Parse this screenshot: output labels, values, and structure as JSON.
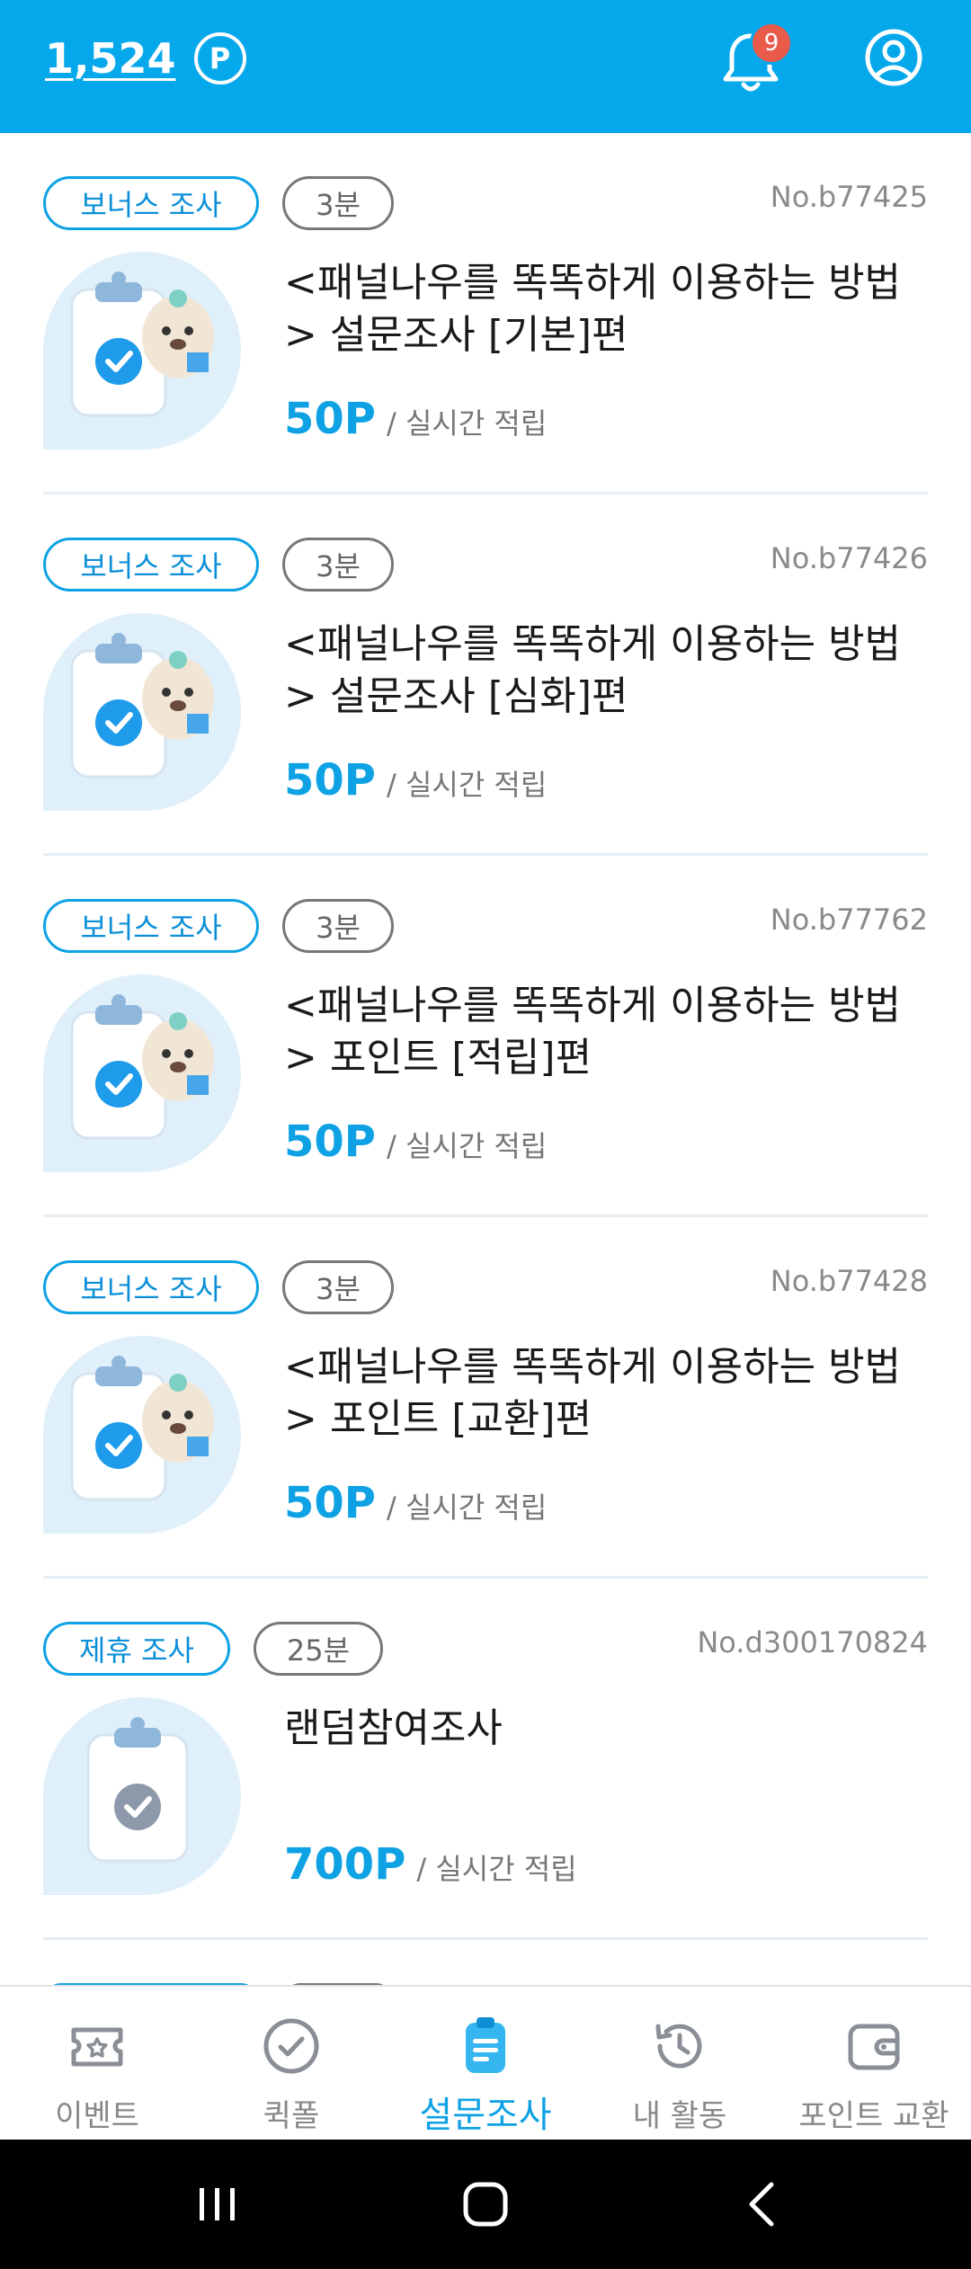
{
  "header": {
    "points": "1,524",
    "points_badge": "P",
    "notification_count": "9"
  },
  "surveys": [
    {
      "tag": "보너스 조사",
      "duration": "3분",
      "number": "No.b77425",
      "title": "<패널나우를 똑똑하게 이용하는 방법> 설문조사 [기본]편",
      "reward": "50P",
      "reward_note": "/ 실시간 적립",
      "thumbnail": "clipboard-bear"
    },
    {
      "tag": "보너스 조사",
      "duration": "3분",
      "number": "No.b77426",
      "title": "<패널나우를 똑똑하게 이용하는 방법> 설문조사 [심화]편",
      "reward": "50P",
      "reward_note": "/ 실시간 적립",
      "thumbnail": "clipboard-bear"
    },
    {
      "tag": "보너스 조사",
      "duration": "3분",
      "number": "No.b77762",
      "title": "<패널나우를 똑똑하게 이용하는 방법> 포인트 [적립]편",
      "reward": "50P",
      "reward_note": "/ 실시간 적립",
      "thumbnail": "clipboard-bear"
    },
    {
      "tag": "보너스 조사",
      "duration": "3분",
      "number": "No.b77428",
      "title": "<패널나우를 똑똑하게 이용하는 방법> 포인트 [교환]편",
      "reward": "50P",
      "reward_note": "/ 실시간 적립",
      "thumbnail": "clipboard-bear"
    },
    {
      "tag": "제휴 조사",
      "duration": "25분",
      "number": "No.d300170824",
      "title": "랜덤참여조사",
      "reward": "700P",
      "reward_note": "/ 실시간 적립",
      "thumbnail": "clipboard-gray"
    }
  ],
  "nav": {
    "items": [
      {
        "label": "이벤트",
        "icon": "event-ticket-icon",
        "active": false
      },
      {
        "label": "퀵폴",
        "icon": "quickpoll-check-icon",
        "active": false
      },
      {
        "label": "설문조사",
        "icon": "survey-document-icon",
        "active": true
      },
      {
        "label": "내 활동",
        "icon": "history-clock-icon",
        "active": false
      },
      {
        "label": "포인트 교환",
        "icon": "wallet-icon",
        "active": false
      }
    ]
  },
  "colors": {
    "brand": "#06a8ec",
    "accent_text": "#0ea2e4",
    "badge_red": "#e85a4a"
  }
}
